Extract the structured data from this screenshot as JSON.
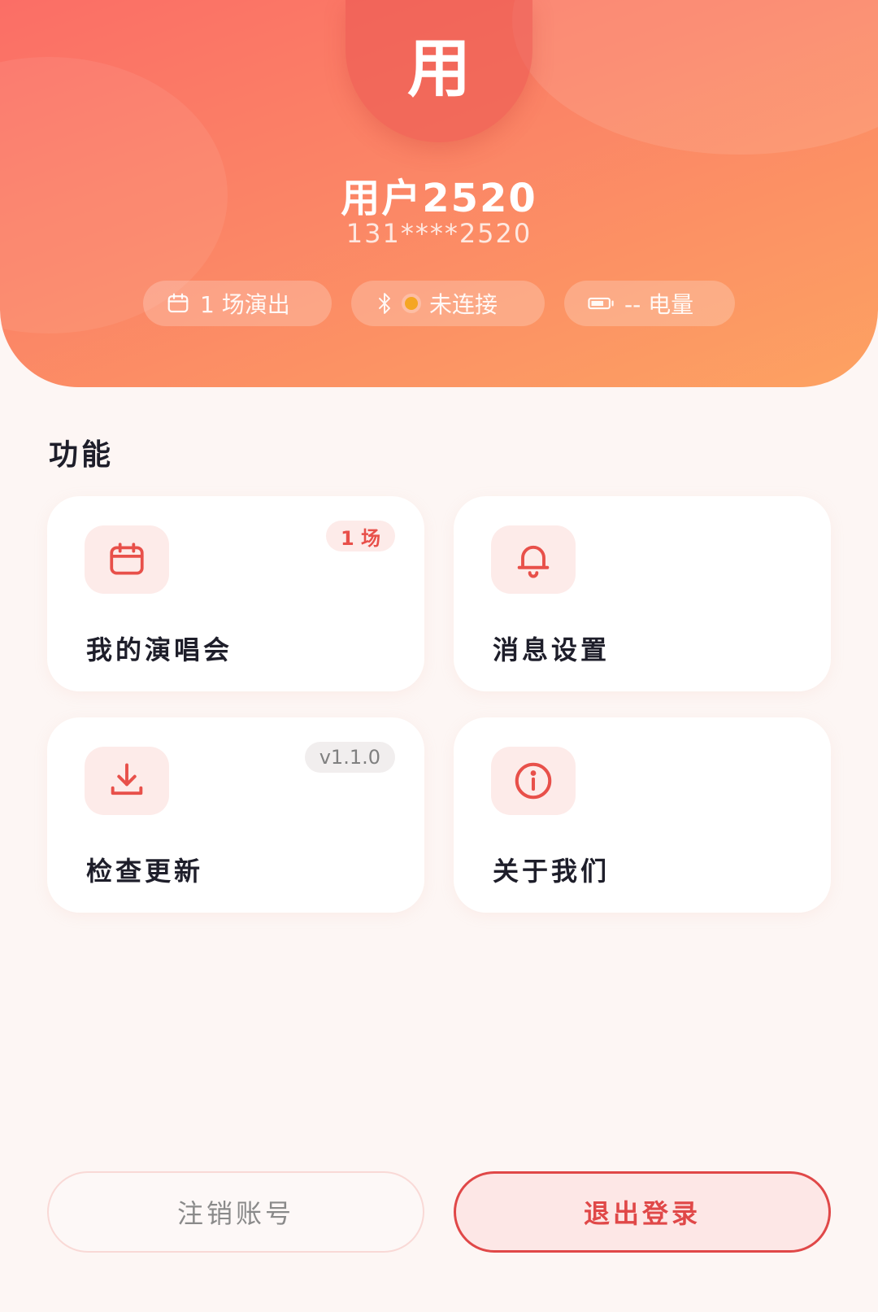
{
  "header": {
    "avatar_char": "用",
    "user_name": "用户2520",
    "phone": "131****2520"
  },
  "stats": [
    {
      "icon": "calendar-icon",
      "label": "1 场演出"
    },
    {
      "icon": "bluetooth-icon",
      "status_dot": "#f5a623",
      "label": "未连接"
    },
    {
      "icon": "battery-icon",
      "label": "-- 电量"
    }
  ],
  "section": {
    "title": "功能"
  },
  "cards": [
    {
      "icon": "calendar-icon",
      "label": "我的演唱会",
      "badge": "1 场"
    },
    {
      "icon": "bell-icon",
      "label": "消息设置"
    },
    {
      "icon": "download-icon",
      "label": "检查更新",
      "badge": "v1.1.0"
    },
    {
      "icon": "info-icon",
      "label": "关于我们"
    }
  ],
  "buttons": {
    "delete_account": "注销账号",
    "logout": "退出登录"
  },
  "colors": {
    "accent": "#e8504a",
    "header_start": "#fb6e66",
    "header_end": "#fda262",
    "background": "#fdf6f4"
  }
}
